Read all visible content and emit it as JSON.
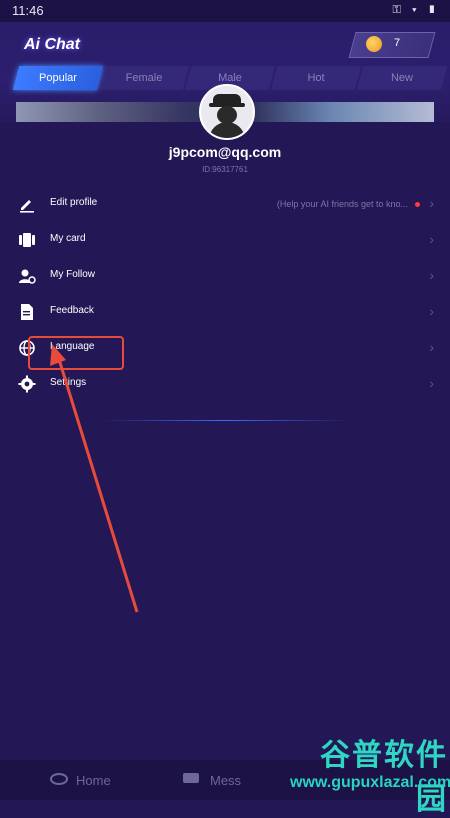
{
  "status": {
    "time": "11:46",
    "icons": "⚿ ▾ ▮"
  },
  "app": {
    "title": "Ai Chat",
    "coins": "7"
  },
  "tabs": [
    {
      "label": "Popular",
      "active": true
    },
    {
      "label": "Female",
      "active": false
    },
    {
      "label": "Male",
      "active": false
    },
    {
      "label": "Hot",
      "active": false
    },
    {
      "label": "New",
      "active": false
    }
  ],
  "profile": {
    "email": "j9pcom@qq.com",
    "id": "ID:96317761"
  },
  "menu": [
    {
      "label": "Edit profile",
      "icon": "edit-icon",
      "hint": "(Help your AI friends get to kno...",
      "has_dot": true
    },
    {
      "label": "My card",
      "icon": "card-icon",
      "hint": "",
      "has_dot": false
    },
    {
      "label": "My Follow",
      "icon": "follow-icon",
      "hint": "",
      "has_dot": false
    },
    {
      "label": "Feedback",
      "icon": "feedback-icon",
      "hint": "",
      "has_dot": false
    },
    {
      "label": "Language",
      "icon": "globe-icon",
      "hint": "",
      "has_dot": false
    },
    {
      "label": "Settings",
      "icon": "gear-icon",
      "hint": "",
      "has_dot": false
    }
  ],
  "bottom_nav": [
    {
      "label": "Home",
      "icon": "home-icon"
    },
    {
      "label": "Mess",
      "icon": "message-icon"
    }
  ],
  "watermark": {
    "cn": "谷普软件园",
    "url": "www.gupuxlazal.com"
  },
  "colors": {
    "accent": "#2b5fe0",
    "background": "#231855",
    "annotation": "#e84a3c"
  }
}
